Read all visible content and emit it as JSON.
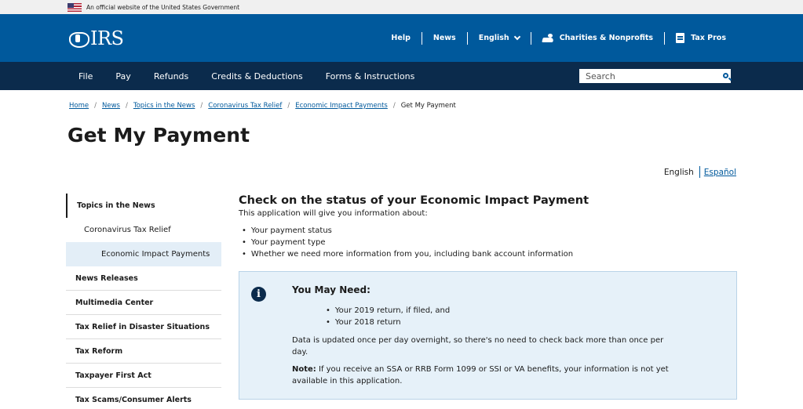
{
  "gov_banner": {
    "text": "An official website of the United States Government"
  },
  "header": {
    "logo_text": "IRS",
    "util_nav": {
      "help": "Help",
      "news": "News",
      "language": "English",
      "charities": "Charities & Nonprofits",
      "tax_pros": "Tax Pros"
    }
  },
  "main_nav": {
    "items": [
      "File",
      "Pay",
      "Refunds",
      "Credits & Deductions",
      "Forms & Instructions"
    ],
    "search_placeholder": "Search"
  },
  "breadcrumb": {
    "items": [
      "Home",
      "News",
      "Topics in the News",
      "Coronavirus Tax Relief",
      "Economic Impact Payments"
    ],
    "current": "Get My Payment",
    "separator": "/"
  },
  "page_title": "Get My Payment",
  "language_toggle": {
    "english": "English",
    "spanish": "Español"
  },
  "sidebar": {
    "items": [
      "Topics in the News",
      "Coronavirus Tax Relief",
      "Economic Impact Payments",
      "News Releases",
      "Multimedia Center",
      "Tax Relief in Disaster Situations",
      "Tax Reform",
      "Taxpayer First Act",
      "Tax Scams/Consumer Alerts"
    ]
  },
  "content": {
    "heading": "Check on the status of your Economic Impact Payment",
    "intro": "This application will give you information about:",
    "bullets": [
      "Your payment status",
      "Your payment type",
      "Whether we need more information from you, including bank account information"
    ]
  },
  "alert": {
    "icon": "info-icon",
    "icon_glyph": "i",
    "title": "You May Need:",
    "items": [
      "Your 2019 return, if filed, and",
      "Your 2018 return"
    ],
    "paragraph": "Data is updated once per day overnight, so there's no need to check back more than once per day.",
    "note_label": "Note:",
    "note_text": " If you receive an SSA or RRB Form 1099 or SSI or VA benefits, your information is not yet available in this application."
  },
  "colors": {
    "header_blue": "#00599c",
    "nav_navy": "#0b2b4c",
    "alert_bg": "#e6f1f9",
    "active_side_bg": "#e3eef7",
    "link": "#00599c"
  }
}
